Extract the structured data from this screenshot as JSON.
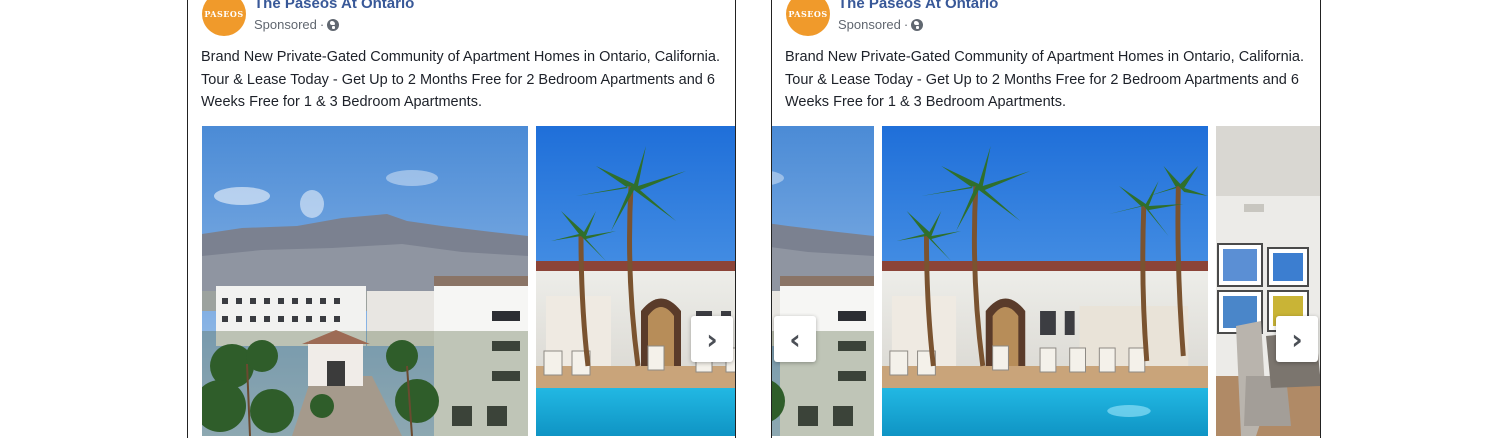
{
  "posts": [
    {
      "page_name": "The Paseos At Ontario",
      "avatar_text": "PASEOS",
      "sponsored": "Sponsored",
      "separator": "·",
      "privacy_icon": "globe-icon",
      "caption": "Brand New Private-Gated Community of Apartment Homes in Ontario, California. Tour & Lease Today - Get Up to 2 Months Free for 2 Bedroom Apartments and 6 Weeks Free for 1 & 3 Bedroom Apartments.",
      "next_arrow": "›"
    },
    {
      "page_name": "The Paseos At Ontario",
      "avatar_text": "PASEOS",
      "sponsored": "Sponsored",
      "separator": "·",
      "privacy_icon": "globe-icon",
      "caption": "Brand New Private-Gated Community of Apartment Homes in Ontario, California. Tour & Lease Today - Get Up to 2 Months Free for 2 Bedroom Apartments and 6 Weeks Free for 1 & 3 Bedroom Apartments.",
      "prev_arrow": "‹",
      "next_arrow": "›"
    }
  ],
  "colors": {
    "brand_orange": "#f09a2b",
    "link_blue": "#385898",
    "sky": "#4e8fd8",
    "pool": "#15a9d6"
  }
}
